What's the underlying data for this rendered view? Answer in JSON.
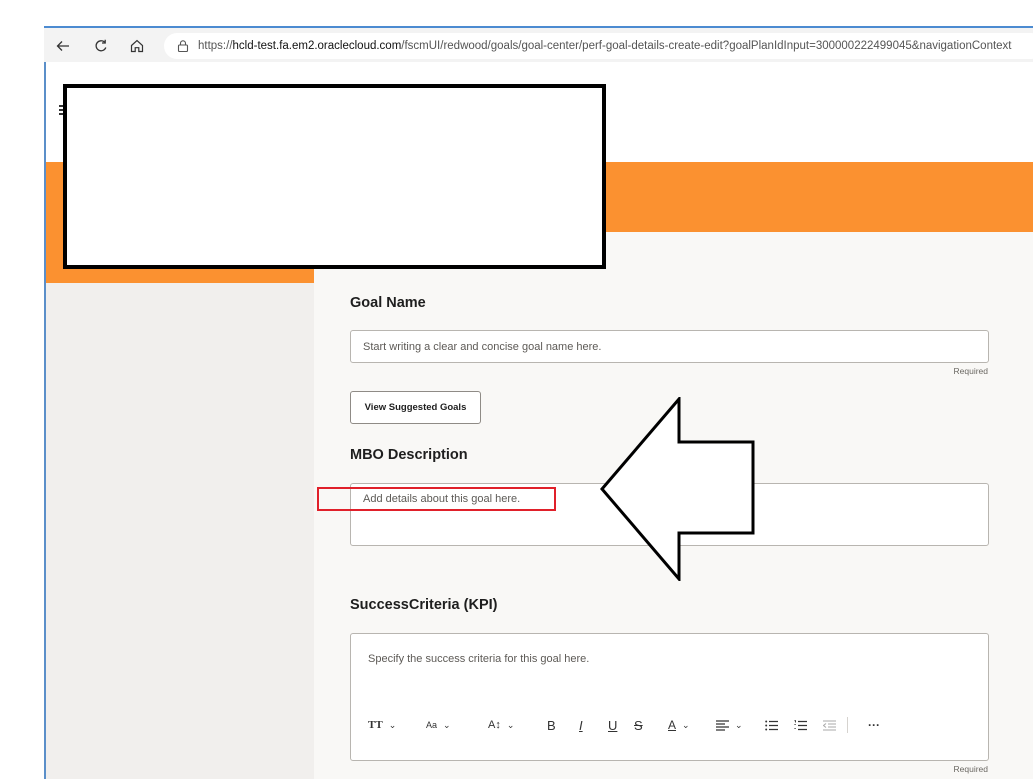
{
  "browser": {
    "url_prefix": "https://",
    "url_host": "hcld-test.fa.em2.oraclecloud.com",
    "url_path": "/fscmUI/redwood/goals/goal-center/perf-goal-details-create-edit?goalPlanIdInput=300000222499045&navigationContext",
    "back_icon": "arrow-left-icon",
    "refresh_icon": "refresh-icon",
    "home_icon": "home-icon",
    "lock_icon": "lock-icon"
  },
  "form": {
    "goal_name": {
      "label": "Goal Name",
      "placeholder": "Start writing a clear and concise goal name here.",
      "required": "Required"
    },
    "suggested_button": "View Suggested Goals",
    "mbo_description": {
      "label": "MBO Description",
      "placeholder": "Add details about this goal here."
    },
    "success_criteria": {
      "label": "SuccessCriteria (KPI)",
      "placeholder": "Specify the success criteria for this goal here.",
      "required": "Required"
    },
    "toolbar": {
      "font_family_glyph": "TT",
      "font_size_glyph": "Aa",
      "line_height_glyph": "A↕",
      "bold_glyph": "B",
      "italic_glyph": "I",
      "underline_glyph": "U",
      "strike_glyph": "S",
      "color_glyph": "A",
      "more_glyph": "···"
    }
  },
  "colors": {
    "orange_band": "#fb9130",
    "annotation_red": "#e0202a"
  }
}
